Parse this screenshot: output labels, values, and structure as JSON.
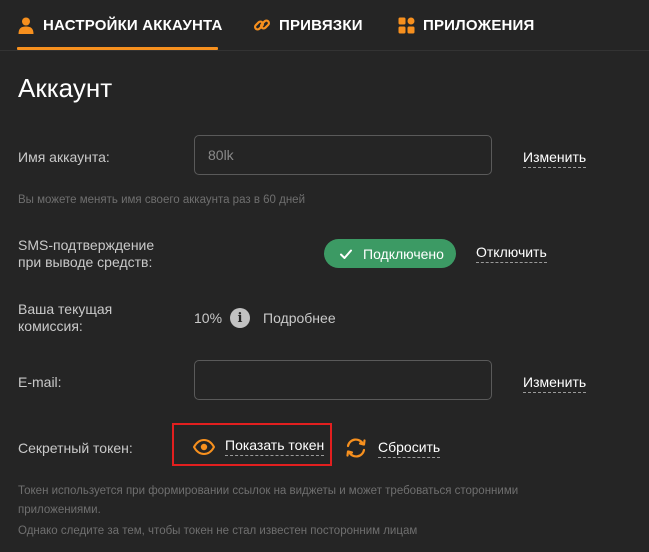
{
  "tabs": [
    {
      "label": "НАСТРОЙКИ АККАУНТА",
      "icon": "user-icon",
      "active": true
    },
    {
      "label": "ПРИВЯЗКИ",
      "icon": "link-icon",
      "active": false
    },
    {
      "label": "ПРИЛОЖЕНИЯ",
      "icon": "apps-grid-icon",
      "active": false
    }
  ],
  "accent_color": "#f7901e",
  "success_color": "#3c9a64",
  "page_title": "Аккаунт",
  "account_name": {
    "label": "Имя аккаунта:",
    "value": "80lk",
    "action": "Изменить",
    "hint": "Вы можете менять имя своего аккаунта раз в 60 дней"
  },
  "sms": {
    "label_line1": "SMS-подтверждение",
    "label_line2": "при выводе средств:",
    "status": "Подключено",
    "action": "Отключить"
  },
  "commission": {
    "label_line1": "Ваша текущая",
    "label_line2": "комиссия:",
    "value": "10%",
    "info_glyph": "i",
    "more": "Подробнее"
  },
  "email": {
    "label": "E-mail:",
    "value": "",
    "action": "Изменить"
  },
  "token": {
    "label": "Секретный токен:",
    "show": "Показать токен",
    "reset": "Сбросить",
    "hint_line1": "Токен используется при формировании ссылок на виджеты и может требоваться сторонними",
    "hint_line2": "приложениями.",
    "hint_line3": "Однако следите за тем, чтобы токен не стал известен посторонним лицам"
  }
}
